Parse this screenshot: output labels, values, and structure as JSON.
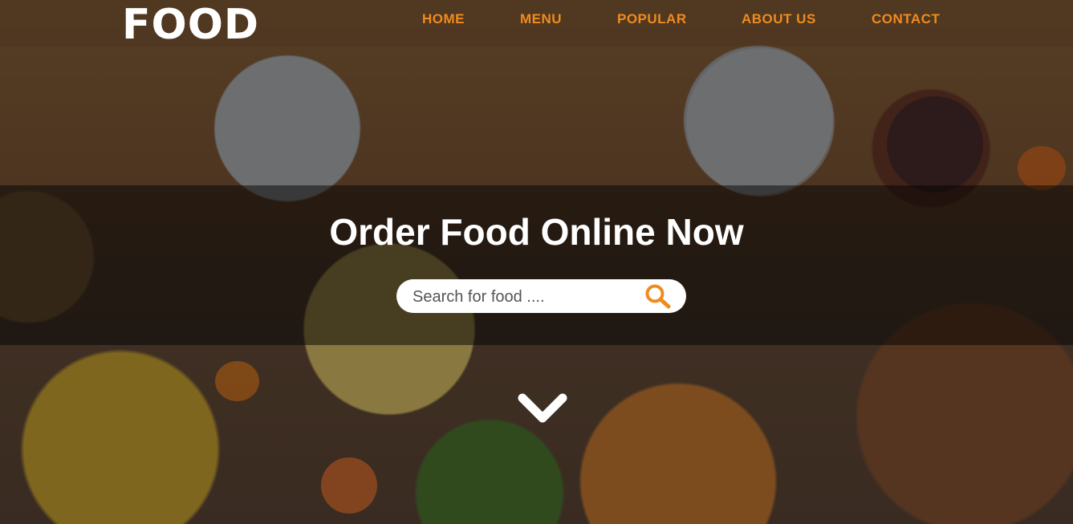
{
  "header": {
    "logo_text": "FOOD",
    "nav": [
      {
        "label": "HOME"
      },
      {
        "label": "MENU"
      },
      {
        "label": "POPULAR"
      },
      {
        "label": "ABOUT US"
      },
      {
        "label": "CONTACT"
      }
    ]
  },
  "hero": {
    "headline": "Order Food Online Now",
    "search_placeholder": "Search for food ...."
  },
  "icons": {
    "search": "search-icon",
    "scroll_down": "chevron-down-icon"
  },
  "colors": {
    "accent": "#f08b1e",
    "text_light": "#ffffff",
    "band_overlay": "rgba(0,0,0,0.48)"
  }
}
